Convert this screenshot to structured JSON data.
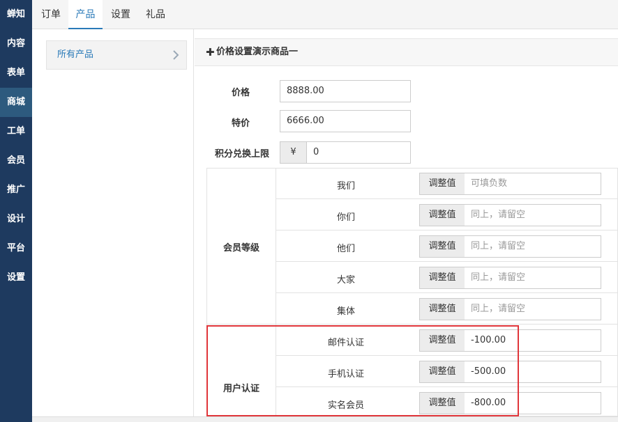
{
  "sidebar": {
    "logo": "蝉知",
    "items": [
      {
        "label": "内容"
      },
      {
        "label": "表单"
      },
      {
        "label": "商城",
        "active": true
      },
      {
        "label": "工单"
      },
      {
        "label": "会员"
      },
      {
        "label": "推广"
      },
      {
        "label": "设计"
      },
      {
        "label": "平台"
      },
      {
        "label": "设置"
      }
    ]
  },
  "topnav": {
    "tabs": [
      {
        "label": "订单"
      },
      {
        "label": "产品",
        "active": true
      },
      {
        "label": "设置"
      },
      {
        "label": "礼品"
      }
    ]
  },
  "category_panel": {
    "label": "所有产品",
    "chevron_icon": "chevron-right-icon"
  },
  "header": {
    "icon": "plus-icon",
    "title": "价格设置演示商品一"
  },
  "form": {
    "price_label": "价格",
    "price_value": "8888.00",
    "special_label": "特价",
    "special_value": "6666.00",
    "points_label": "积分兑换上限",
    "points_prefix": "¥",
    "points_value": "0"
  },
  "member_group": {
    "label": "会员等级",
    "rows": [
      {
        "name": "我们",
        "button": "调整值",
        "value": "",
        "placeholder": "可填负数"
      },
      {
        "name": "你们",
        "button": "调整值",
        "value": "",
        "placeholder": "同上，请留空"
      },
      {
        "name": "他们",
        "button": "调整值",
        "value": "",
        "placeholder": "同上，请留空"
      },
      {
        "name": "大家",
        "button": "调整值",
        "value": "",
        "placeholder": "同上，请留空"
      },
      {
        "name": "集体",
        "button": "调整值",
        "value": "",
        "placeholder": "同上，请留空"
      }
    ]
  },
  "auth_group": {
    "label": "用户认证",
    "rows": [
      {
        "name": "邮件认证",
        "button": "调整值",
        "value": "-100.00",
        "placeholder": ""
      },
      {
        "name": "手机认证",
        "button": "调整值",
        "value": "-500.00",
        "placeholder": ""
      },
      {
        "name": "实名会员",
        "button": "调整值",
        "value": "-800.00",
        "placeholder": ""
      }
    ]
  },
  "colors": {
    "sidebar_bg": "#1e3a5f",
    "sidebar_active": "#2d5a7e",
    "accent": "#2a7ab8",
    "highlight_border": "#e0353a"
  }
}
